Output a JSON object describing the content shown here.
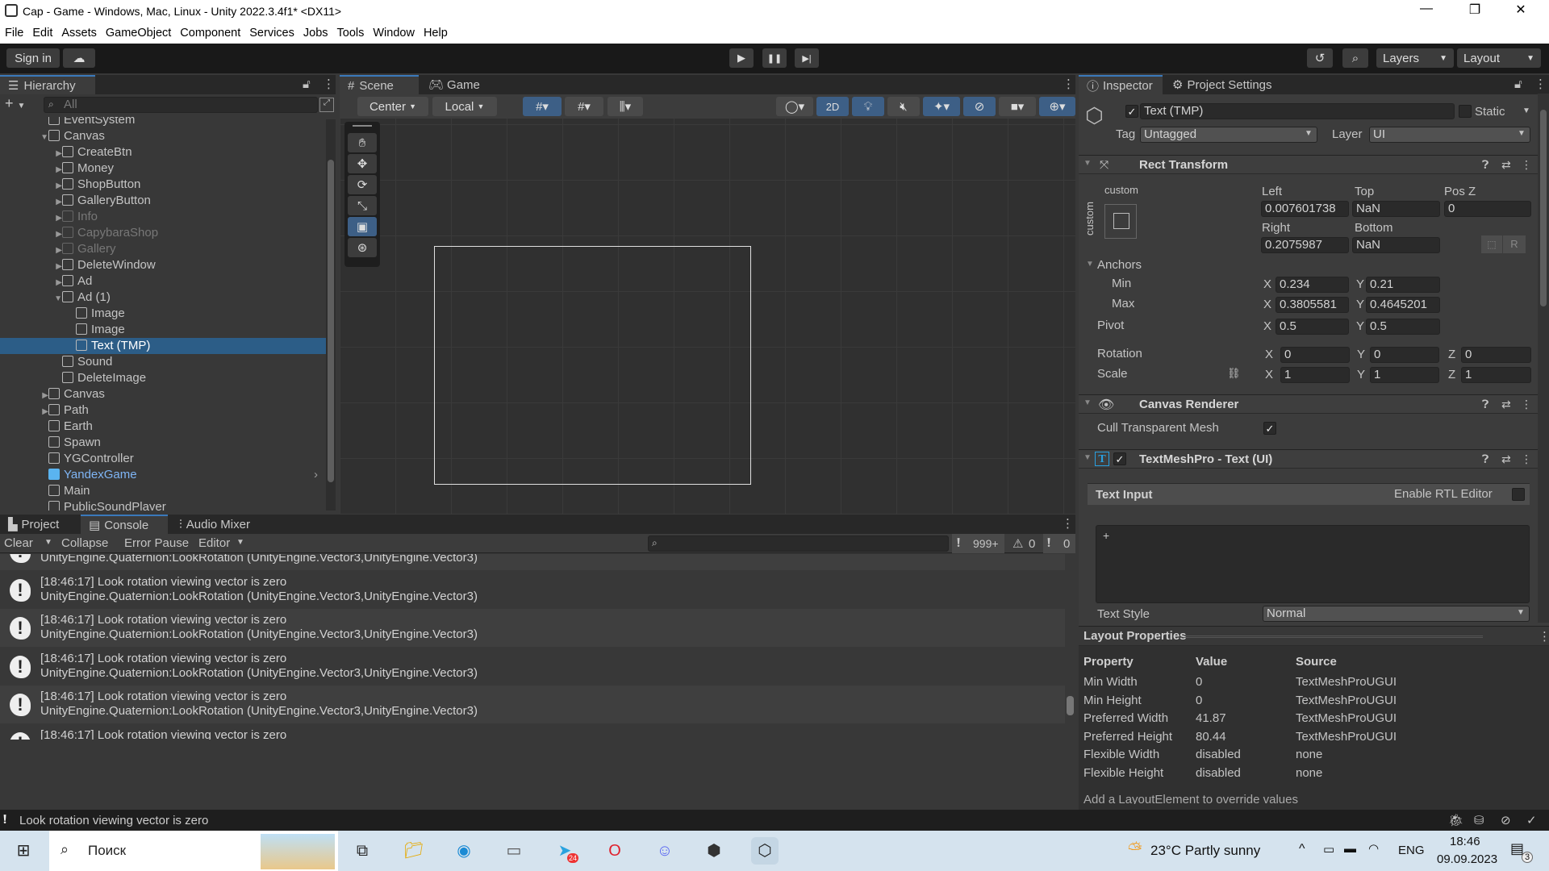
{
  "window": {
    "title": "Cap - Game - Windows, Mac, Linux - Unity 2022.3.4f1* <DX11>",
    "minimize": "—",
    "maximize": "❐",
    "close": "✕"
  },
  "menu": [
    "File",
    "Edit",
    "Assets",
    "GameObject",
    "Component",
    "Services",
    "Jobs",
    "Tools",
    "Window",
    "Help"
  ],
  "toolbar": {
    "sign_in": "Sign in",
    "layers": "Layers",
    "layout": "Layout",
    "play": "▶",
    "pause": "❚❚",
    "step": "▶|"
  },
  "hierarchy": {
    "tab": "Hierarchy",
    "search_placeholder": "All",
    "items": [
      {
        "label": "EventSystem",
        "depth": 0,
        "arrow": "",
        "state": ""
      },
      {
        "label": "Canvas",
        "depth": 0,
        "arrow": "▼",
        "state": ""
      },
      {
        "label": "CreateBtn",
        "depth": 1,
        "arrow": "▶",
        "state": ""
      },
      {
        "label": "Money",
        "depth": 1,
        "arrow": "▶",
        "state": ""
      },
      {
        "label": "ShopButton",
        "depth": 1,
        "arrow": "▶",
        "state": ""
      },
      {
        "label": "GalleryButton",
        "depth": 1,
        "arrow": "▶",
        "state": ""
      },
      {
        "label": "Info",
        "depth": 1,
        "arrow": "▶",
        "state": "dis"
      },
      {
        "label": "CapybaraShop",
        "depth": 1,
        "arrow": "▶",
        "state": "dis"
      },
      {
        "label": "Gallery",
        "depth": 1,
        "arrow": "▶",
        "state": "dis"
      },
      {
        "label": "DeleteWindow",
        "depth": 1,
        "arrow": "▶",
        "state": ""
      },
      {
        "label": "Ad",
        "depth": 1,
        "arrow": "▶",
        "state": ""
      },
      {
        "label": "Ad (1)",
        "depth": 1,
        "arrow": "▼",
        "state": ""
      },
      {
        "label": "Image",
        "depth": 2,
        "arrow": "",
        "state": ""
      },
      {
        "label": "Image",
        "depth": 2,
        "arrow": "",
        "state": ""
      },
      {
        "label": "Text (TMP)",
        "depth": 2,
        "arrow": "",
        "state": "sel"
      },
      {
        "label": "Sound",
        "depth": 1,
        "arrow": "",
        "state": ""
      },
      {
        "label": "DeleteImage",
        "depth": 1,
        "arrow": "",
        "state": ""
      },
      {
        "label": "Canvas",
        "depth": 0,
        "arrow": "▶",
        "state": ""
      },
      {
        "label": "Path",
        "depth": 0,
        "arrow": "▶",
        "state": ""
      },
      {
        "label": "Earth",
        "depth": 0,
        "arrow": "",
        "state": ""
      },
      {
        "label": "Spawn",
        "depth": 0,
        "arrow": "",
        "state": ""
      },
      {
        "label": "YGController",
        "depth": 0,
        "arrow": "",
        "state": ""
      },
      {
        "label": "YandexGame",
        "depth": 0,
        "arrow": "",
        "state": "prefab"
      },
      {
        "label": "Main",
        "depth": 0,
        "arrow": "",
        "state": ""
      },
      {
        "label": "PublicSoundPlayer",
        "depth": 0,
        "arrow": "",
        "state": ""
      }
    ]
  },
  "scene": {
    "tabs": [
      "Scene",
      "Game"
    ],
    "pivot": "Center",
    "space": "Local",
    "mode_2d": "2D"
  },
  "inspector": {
    "tabs": [
      "Inspector",
      "Project Settings"
    ],
    "object_name": "Text (TMP)",
    "static": "Static",
    "tag_label": "Tag",
    "tag": "Untagged",
    "layer_label": "Layer",
    "layer": "UI",
    "rect_transform": {
      "title": "Rect Transform",
      "preset": "custom",
      "preset_side": "custom",
      "left_label": "Left",
      "top_label": "Top",
      "posz_label": "Pos Z",
      "left": "0.007601738",
      "top": "NaN",
      "posz": "0",
      "right_label": "Right",
      "bottom_label": "Bottom",
      "right": "0.2075987",
      "bottom": "NaN",
      "r_btn": "R",
      "anchors": "Anchors",
      "min": "Min",
      "max": "Max",
      "pivot": "Pivot",
      "min_x": "0.234",
      "min_y": "0.21",
      "max_x": "0.3805581",
      "max_y": "0.4645201",
      "pivot_x": "0.5",
      "pivot_y": "0.5",
      "rotation": "Rotation",
      "scale": "Scale",
      "rot_x": "0",
      "rot_y": "0",
      "rot_z": "0",
      "scale_x": "1",
      "scale_y": "1",
      "scale_z": "1",
      "x": "X",
      "y": "Y",
      "z": "Z"
    },
    "canvas_renderer": {
      "title": "Canvas Renderer",
      "cull_label": "Cull Transparent Mesh",
      "cull": true
    },
    "tmp": {
      "title": "TextMeshPro - Text (UI)",
      "text_input": "Text Input",
      "rtl": "Enable RTL Editor",
      "text_value": "+",
      "text_style_label": "Text Style",
      "text_style": "Normal"
    },
    "layout": {
      "title": "Layout Properties",
      "headers": [
        "Property",
        "Value",
        "Source"
      ],
      "rows": [
        [
          "Min Width",
          "0",
          "TextMeshProUGUI"
        ],
        [
          "Min Height",
          "0",
          "TextMeshProUGUI"
        ],
        [
          "Preferred Width",
          "41.87",
          "TextMeshProUGUI"
        ],
        [
          "Preferred Height",
          "80.44",
          "TextMeshProUGUI"
        ],
        [
          "Flexible Width",
          "disabled",
          "none"
        ],
        [
          "Flexible Height",
          "disabled",
          "none"
        ]
      ],
      "note": "Add a LayoutElement to override values"
    }
  },
  "bottom": {
    "tabs": [
      "Project",
      "Console",
      "Audio Mixer"
    ],
    "clear": "Clear",
    "collapse": "Collapse",
    "error_pause": "Error Pause",
    "editor": "Editor",
    "count_errors": "999+",
    "count_warnings": "0",
    "count_info": "0",
    "logs": [
      {
        "l1": "[18:46:17] Look rotation viewing vector is zero",
        "l2": "UnityEngine.Quaternion:LookRotation (UnityEngine.Vector3,UnityEngine.Vector3)"
      },
      {
        "l1": "[18:46:17] Look rotation viewing vector is zero",
        "l2": "UnityEngine.Quaternion:LookRotation (UnityEngine.Vector3,UnityEngine.Vector3)"
      },
      {
        "l1": "[18:46:17] Look rotation viewing vector is zero",
        "l2": "UnityEngine.Quaternion:LookRotation (UnityEngine.Vector3,UnityEngine.Vector3)"
      },
      {
        "l1": "[18:46:17] Look rotation viewing vector is zero",
        "l2": "UnityEngine.Quaternion:LookRotation (UnityEngine.Vector3,UnityEngine.Vector3)"
      },
      {
        "l1": "[18:46:17] Look rotation viewing vector is zero",
        "l2": "UnityEngine.Quaternion:LookRotation (UnityEngine.Vector3,UnityEngine.Vector3)"
      }
    ]
  },
  "status": {
    "message": "Look rotation viewing vector is zero"
  },
  "taskbar": {
    "search": "Поиск",
    "weather": "23°C  Partly sunny",
    "lang": "ENG",
    "time": "18:46",
    "date": "09.09.2023",
    "notifications": "3",
    "telegram_badge": "24"
  },
  "colors": {
    "accent": "#3a79bb",
    "selection": "#2c5d87",
    "panel": "#383838"
  }
}
